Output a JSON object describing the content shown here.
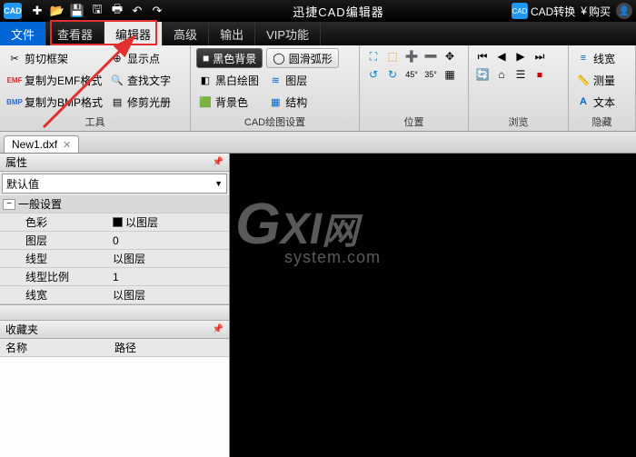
{
  "titlebar": {
    "app_icon_text": "CAD",
    "title": "迅捷CAD编辑器",
    "cad_convert_icon": "CAD",
    "cad_convert_label": "CAD转换",
    "buy_label": "购买"
  },
  "menu": {
    "file": "文件",
    "viewer": "查看器",
    "editor": "编辑器",
    "advanced": "高级",
    "output": "输出",
    "vip": "VIP功能"
  },
  "ribbon": {
    "tools_group": "工具",
    "draw_group": "CAD绘图设置",
    "position_group": "位置",
    "browse_group": "浏览",
    "hide_group": "隐藏",
    "clip_frame": "剪切框架",
    "copy_emf": "复制为EMF格式",
    "copy_bmp": "复制为BMP格式",
    "show_point": "显示点",
    "find_text": "查找文字",
    "trim_clip": "修剪光册",
    "black_bg": "黑色背景",
    "bw_draw": "黑白绘图",
    "bg_color": "背景色",
    "smooth_arc": "圆滑弧形",
    "layer": "图层",
    "structure": "结构",
    "line_width": "线宽",
    "measure": "测量",
    "text": "文本"
  },
  "doc_tab": "New1.dxf",
  "props": {
    "panel_title": "属性",
    "default_value": "默认值",
    "section_general": "一般设置",
    "rows": [
      {
        "k": "色彩",
        "v": "以图层",
        "swatch": true
      },
      {
        "k": "图层",
        "v": "0"
      },
      {
        "k": "线型",
        "v": "以图层"
      },
      {
        "k": "线型比例",
        "v": "1"
      },
      {
        "k": "线宽",
        "v": "以图层"
      }
    ]
  },
  "fav": {
    "panel_title": "收藏夹",
    "col_name": "名称",
    "col_path": "路径"
  },
  "watermark": {
    "g": "G",
    "x": "X",
    "i": "I",
    "net": "网",
    "sub": "system.com"
  }
}
